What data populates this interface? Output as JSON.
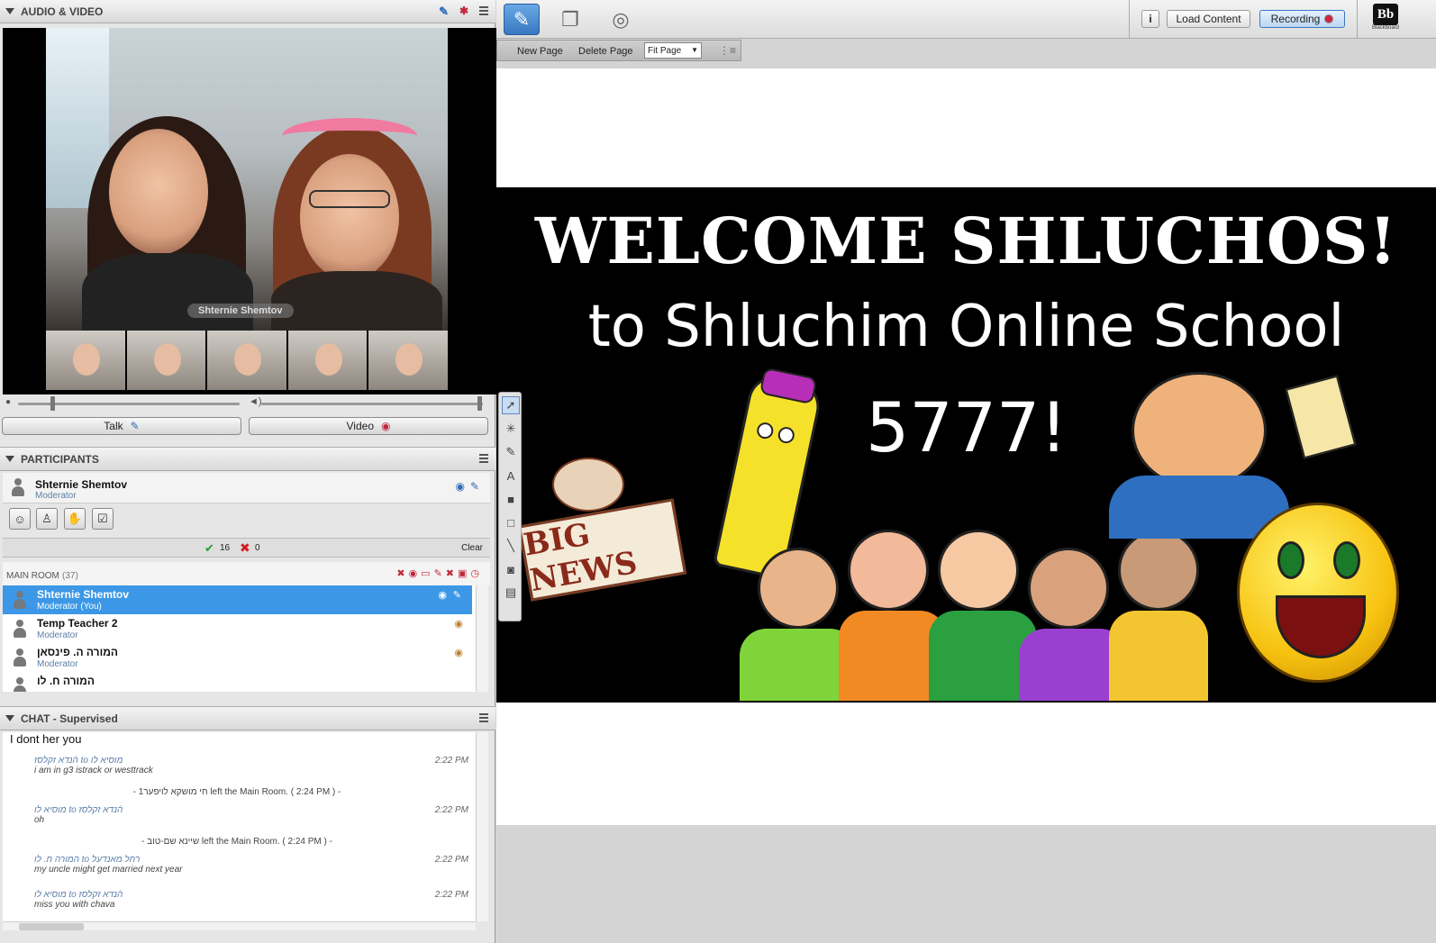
{
  "audio_video": {
    "title": "AUDIO & VIDEO",
    "speaker_label": "Shternie Shemtov",
    "talk_label": "Talk",
    "video_label": "Video"
  },
  "participants": {
    "title": "PARTICIPANTS",
    "me": {
      "name": "Shternie Shemtov",
      "role": "Moderator"
    },
    "yes_count": "16",
    "no_count": "0",
    "clear_label": "Clear",
    "room_label": "MAIN ROOM",
    "room_count": "(37)",
    "list": [
      {
        "name": "Shternie Shemtov",
        "role": "Moderator (You)"
      },
      {
        "name": "Temp Teacher 2",
        "role": "Moderator"
      },
      {
        "name": "המורה ה. פינסאן",
        "role": "Moderator"
      },
      {
        "name": "המורה ח. לו",
        "role": ""
      }
    ]
  },
  "chat": {
    "title": "CHAT - Supervised",
    "input_text": "I dont her you",
    "messages": [
      {
        "from": "הֿנדא זקלסזּ to מוסיא לו",
        "text": "i am in g3 istrack or westtrack",
        "time": "2:22 PM"
      },
      {
        "system": "- חי מושקא לויפער1  left the Main Room. ( 2:24 PM ) -"
      },
      {
        "from": "מוסיא לו to הֿנדא זקלסזּ",
        "text": "oh",
        "time": "2:22 PM"
      },
      {
        "system": "- שיינא שם-טוב left the Main Room. ( 2:24 PM ) -"
      },
      {
        "from": "המורה ח. לו to רחל מאנדעל",
        "text": "my uncle might get married next year",
        "time": "2:22 PM"
      },
      {
        "from": "מוסיא לו to הֿנדא זקלסזּ",
        "text": "miss you with chava",
        "time": "2:22 PM"
      }
    ]
  },
  "toolbar": {
    "load_content": "Load Content",
    "recording": "Recording",
    "info": "i",
    "bb_logo": "Bb",
    "bb_sub": "Blackboard"
  },
  "whiteboard": {
    "new_page": "New Page",
    "delete_page": "Delete Page",
    "zoom": "Fit Page"
  },
  "slide": {
    "line1": "WELCOME SHLUCHOS!",
    "line2": "to Shluchim Online School",
    "line3": "5777!",
    "sign": "BIG NEWS"
  },
  "colors": {
    "selected_row": "#3c98e6",
    "banner_bg": "#000000",
    "recording_dot": "#d0263b"
  }
}
